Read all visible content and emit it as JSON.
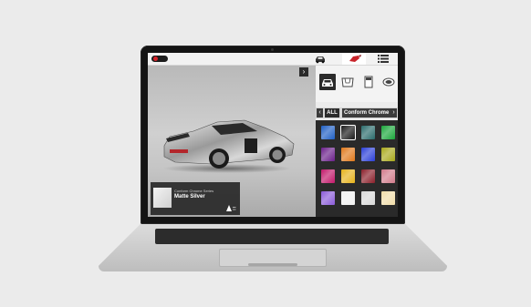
{
  "app": {
    "top_nav": [
      {
        "icon": "car-icon",
        "active": false
      },
      {
        "icon": "paint-icon",
        "active": true
      },
      {
        "icon": "list-icon",
        "active": false
      }
    ],
    "viewer": {
      "collapse_label": "›",
      "swatch_card": {
        "series": "Conform Chrome Series",
        "name": "Matte Silver",
        "brand_icon": "avery-dennison-logo-icon"
      }
    },
    "panel": {
      "categories": [
        {
          "icon": "car-front-icon",
          "active": true
        },
        {
          "icon": "hood-icon",
          "active": false
        },
        {
          "icon": "door-icon",
          "active": false
        },
        {
          "icon": "mirror-icon",
          "active": false
        }
      ],
      "filter": {
        "all_label": "ALL",
        "current": "Conform Chrome",
        "prev_label": "‹",
        "next_label": "›"
      },
      "swatches": [
        {
          "color": "#1f5fc4"
        },
        {
          "color": "#1a1a1a",
          "selected": true
        },
        {
          "color": "#2a6b6b"
        },
        {
          "color": "#1aa63a"
        },
        {
          "color": "#6a1f8a"
        },
        {
          "color": "#e0781a"
        },
        {
          "color": "#2b3fd8"
        },
        {
          "color": "#a8a81a"
        },
        {
          "color": "#c2186a"
        },
        {
          "color": "#e6b21a"
        },
        {
          "color": "#8a1f2a"
        },
        {
          "color": "#d07a8a"
        },
        {
          "color": "#8a5ad8"
        },
        {
          "color": "#f0f0f0"
        },
        {
          "color": "#d8d8d8"
        },
        {
          "color": "#f0dca8"
        }
      ]
    }
  }
}
